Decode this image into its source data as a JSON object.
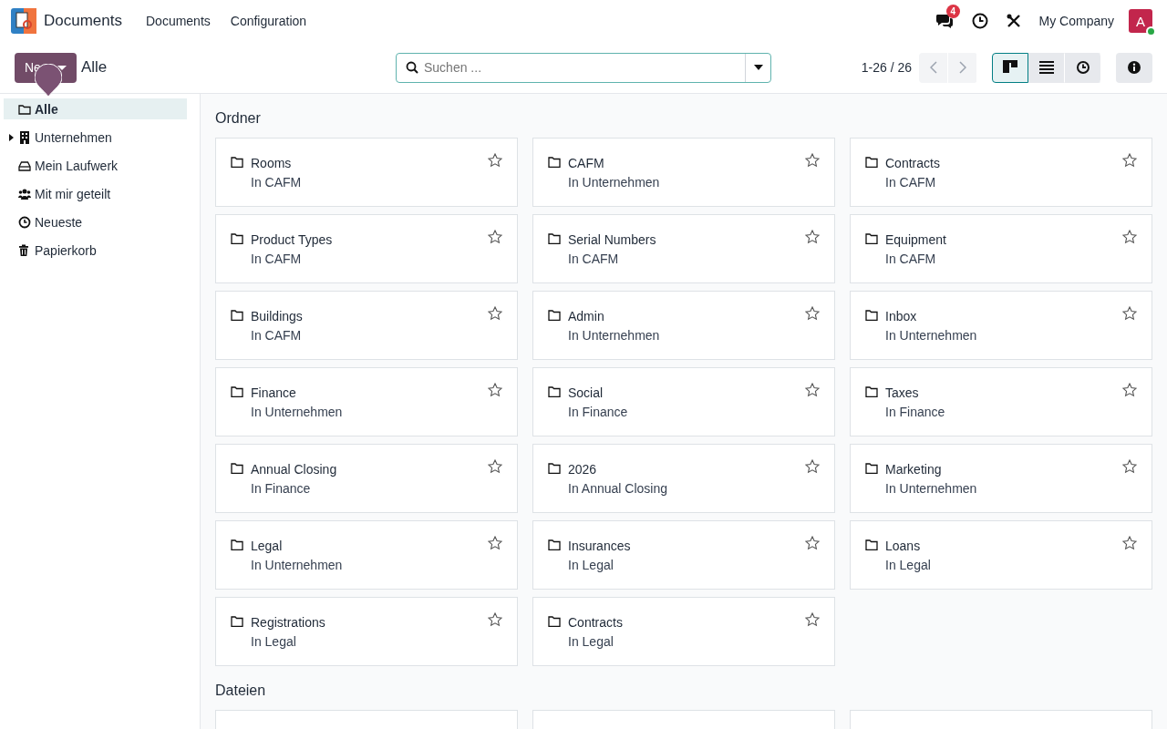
{
  "navbar": {
    "app_name": "Documents",
    "menu": [
      "Documents",
      "Configuration"
    ],
    "messages_badge": "4",
    "company": "My Company",
    "avatar_letter": "A",
    "online": true
  },
  "control_panel": {
    "new_button": "Ne",
    "breadcrumb": "Alle",
    "search": {
      "placeholder": "Suchen ..."
    },
    "pager": "1-26 / 26",
    "views": [
      {
        "kind": "kanban",
        "selected": true
      },
      {
        "kind": "list",
        "selected": false
      },
      {
        "kind": "activity",
        "selected": false
      }
    ]
  },
  "sidebar": {
    "items": [
      {
        "label": "Alle",
        "kind": "folder",
        "selected": true
      },
      {
        "label": "Unternehmen",
        "kind": "company",
        "selected": false,
        "expanded": false
      },
      {
        "label": "Mein Laufwerk",
        "kind": "drive",
        "selected": false
      },
      {
        "label": "Mit mir geteilt",
        "kind": "shared",
        "selected": false
      },
      {
        "label": "Neueste",
        "kind": "recent",
        "selected": false
      },
      {
        "label": "Papierkorb",
        "kind": "trash",
        "selected": false
      }
    ]
  },
  "sections": [
    {
      "title": "Ordner",
      "cards": [
        {
          "name": "Rooms",
          "parent": "In CAFM",
          "starred": false
        },
        {
          "name": "CAFM",
          "parent": "In Unternehmen",
          "starred": false
        },
        {
          "name": "Contracts",
          "parent": "In CAFM",
          "starred": false
        },
        {
          "name": "Product Types",
          "parent": "In CAFM",
          "starred": false
        },
        {
          "name": "Serial Numbers",
          "parent": "In CAFM",
          "starred": false
        },
        {
          "name": "Equipment",
          "parent": "In CAFM",
          "starred": false
        },
        {
          "name": "Buildings",
          "parent": "In CAFM",
          "starred": false
        },
        {
          "name": "Admin",
          "parent": "In Unternehmen",
          "starred": false
        },
        {
          "name": "Inbox",
          "parent": "In Unternehmen",
          "starred": false
        },
        {
          "name": "Finance",
          "parent": "In Unternehmen",
          "starred": false
        },
        {
          "name": "Social",
          "parent": "In Finance",
          "starred": false
        },
        {
          "name": "Taxes",
          "parent": "In Finance",
          "starred": false
        },
        {
          "name": "Annual Closing",
          "parent": "In Finance",
          "starred": false
        },
        {
          "name": "2026",
          "parent": "In Annual Closing",
          "starred": false
        },
        {
          "name": "Marketing",
          "parent": "In Unternehmen",
          "starred": false
        },
        {
          "name": "Legal",
          "parent": "In Unternehmen",
          "starred": false
        },
        {
          "name": "Insurances",
          "parent": "In Legal",
          "starred": false
        },
        {
          "name": "Loans",
          "parent": "In Legal",
          "starred": false
        },
        {
          "name": "Registrations",
          "parent": "In Legal",
          "starred": false
        },
        {
          "name": "Contracts",
          "parent": "In Legal",
          "starred": false
        }
      ]
    },
    {
      "title": "Dateien",
      "cards": [
        {
          "kind": "blank"
        },
        {
          "kind": "blank"
        },
        {
          "kind": "blank"
        }
      ]
    }
  ]
}
